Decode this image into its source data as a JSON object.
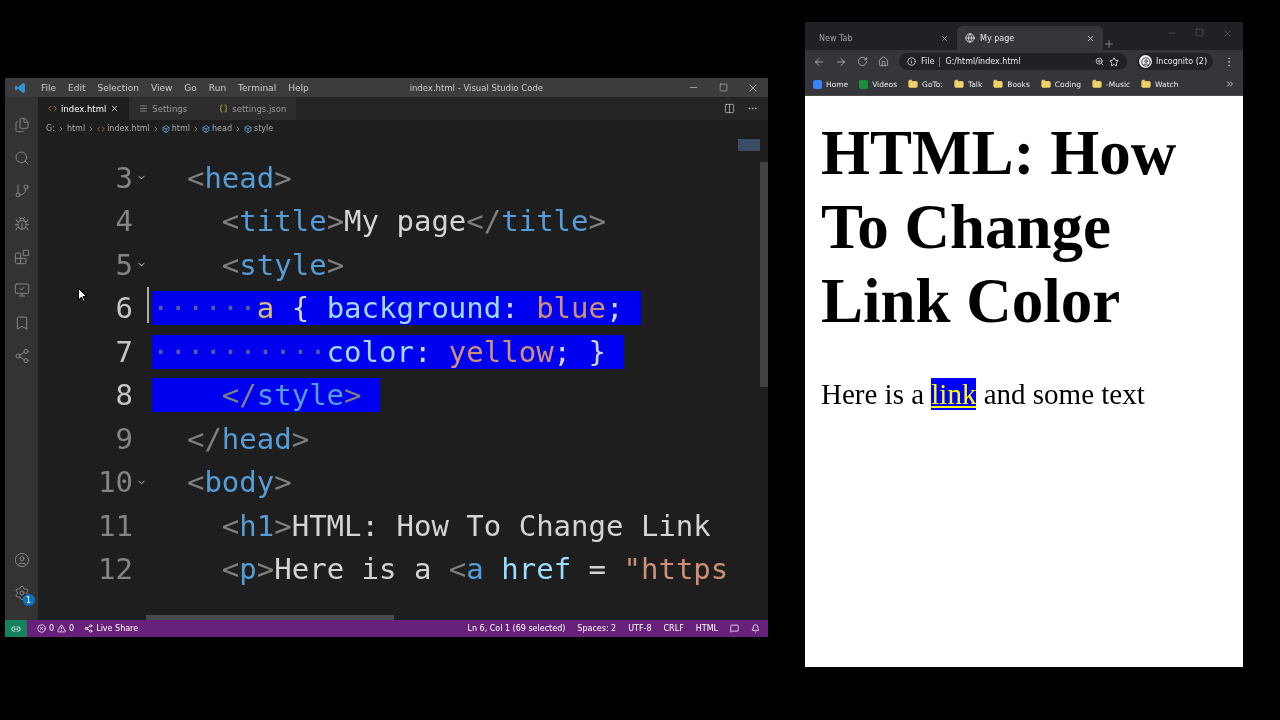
{
  "vscode": {
    "menu": [
      "File",
      "Edit",
      "Selection",
      "View",
      "Go",
      "Run",
      "Terminal",
      "Help"
    ],
    "title": "index.html - Visual Studio Code",
    "tabs": [
      {
        "label": "index.html",
        "kind": "html",
        "selected": true
      },
      {
        "label": "Settings",
        "kind": "settings",
        "selected": false
      },
      {
        "label": "settings.json",
        "kind": "json",
        "selected": false
      }
    ],
    "breadcrumbs": [
      {
        "label": "G:",
        "kind": "drive"
      },
      {
        "label": "html",
        "kind": "folder"
      },
      {
        "label": "index.html",
        "kind": "html"
      },
      {
        "label": "html",
        "kind": "element"
      },
      {
        "label": "head",
        "kind": "element"
      },
      {
        "label": "style",
        "kind": "element"
      }
    ],
    "lines": [
      {
        "number": "3",
        "foldable": true,
        "selected": false,
        "segments": [
          {
            "kind": "punct",
            "text": "  <"
          },
          {
            "kind": "tag",
            "text": "head"
          },
          {
            "kind": "punct",
            "text": ">"
          }
        ]
      },
      {
        "number": "4",
        "foldable": false,
        "selected": false,
        "segments": [
          {
            "kind": "punct",
            "text": "    <"
          },
          {
            "kind": "tag",
            "text": "title"
          },
          {
            "kind": "punct",
            "text": ">"
          },
          {
            "kind": "text",
            "text": "My page"
          },
          {
            "kind": "punct",
            "text": "</"
          },
          {
            "kind": "tag",
            "text": "title"
          },
          {
            "kind": "punct",
            "text": ">"
          }
        ]
      },
      {
        "number": "5",
        "foldable": true,
        "selected": false,
        "segments": [
          {
            "kind": "punct",
            "text": "    <"
          },
          {
            "kind": "tag",
            "text": "style"
          },
          {
            "kind": "punct",
            "text": ">"
          }
        ]
      },
      {
        "number": "6",
        "foldable": false,
        "selected": true,
        "segments": [
          {
            "kind": "ws",
            "text": "······"
          },
          {
            "kind": "selector",
            "text": "a"
          },
          {
            "kind": "text",
            "text": " { "
          },
          {
            "kind": "prop",
            "text": "background"
          },
          {
            "kind": "text",
            "text": ": "
          },
          {
            "kind": "value",
            "text": "blue"
          },
          {
            "kind": "text",
            "text": ";"
          }
        ]
      },
      {
        "number": "7",
        "foldable": false,
        "selected": true,
        "segments": [
          {
            "kind": "ws",
            "text": "··········"
          },
          {
            "kind": "prop",
            "text": "color"
          },
          {
            "kind": "text",
            "text": ": "
          },
          {
            "kind": "value",
            "text": "yellow"
          },
          {
            "kind": "text",
            "text": "; }"
          }
        ]
      },
      {
        "number": "8",
        "foldable": false,
        "selected": true,
        "segments": [
          {
            "kind": "punct",
            "text": "    </"
          },
          {
            "kind": "tag",
            "text": "style"
          },
          {
            "kind": "punct",
            "text": ">"
          }
        ]
      },
      {
        "number": "9",
        "foldable": false,
        "selected": false,
        "segments": [
          {
            "kind": "punct",
            "text": "  </"
          },
          {
            "kind": "tag",
            "text": "head"
          },
          {
            "kind": "punct",
            "text": ">"
          }
        ]
      },
      {
        "number": "10",
        "foldable": true,
        "selected": false,
        "segments": [
          {
            "kind": "punct",
            "text": "  <"
          },
          {
            "kind": "tag",
            "text": "body"
          },
          {
            "kind": "punct",
            "text": ">"
          }
        ]
      },
      {
        "number": "11",
        "foldable": false,
        "selected": false,
        "segments": [
          {
            "kind": "punct",
            "text": "    <"
          },
          {
            "kind": "tag",
            "text": "h1"
          },
          {
            "kind": "punct",
            "text": ">"
          },
          {
            "kind": "text",
            "text": "HTML: How To Change Link"
          }
        ]
      },
      {
        "number": "12",
        "foldable": false,
        "selected": false,
        "segments": [
          {
            "kind": "punct",
            "text": "    <"
          },
          {
            "kind": "tag",
            "text": "p"
          },
          {
            "kind": "punct",
            "text": ">"
          },
          {
            "kind": "text",
            "text": "Here is a "
          },
          {
            "kind": "punct",
            "text": "<"
          },
          {
            "kind": "tag",
            "text": "a"
          },
          {
            "kind": "prop",
            "text": " href"
          },
          {
            "kind": "text",
            "text": " = "
          },
          {
            "kind": "value",
            "text": "\"https"
          }
        ]
      }
    ],
    "status": {
      "errors": "0",
      "warnings": "0",
      "live_share": "Live Share",
      "right": [
        "Ln 6, Col 1 (69 selected)",
        "Spaces: 2",
        "UTF-8",
        "CRLF",
        "HTML"
      ]
    },
    "settings_badge": "1"
  },
  "browser": {
    "tabs": [
      {
        "label": "New Tab",
        "selected": false
      },
      {
        "label": "My page",
        "selected": true
      }
    ],
    "address": {
      "scheme": "File",
      "url": "G:/html/index.html"
    },
    "profile": "Incognito (2)",
    "bookmarks": [
      {
        "label": "Home",
        "kind": "app",
        "color": "#3b82f6"
      },
      {
        "label": "Videos",
        "kind": "app",
        "color": "#1e8e3e"
      },
      {
        "label": "GoTo:",
        "kind": "folder",
        "color": "#f2d06b"
      },
      {
        "label": "Talk",
        "kind": "folder",
        "color": "#f2d06b"
      },
      {
        "label": "Books",
        "kind": "folder",
        "color": "#f2d06b"
      },
      {
        "label": "Coding",
        "kind": "folder",
        "color": "#f2d06b"
      },
      {
        "label": "-Music",
        "kind": "folder",
        "color": "#f2d06b"
      },
      {
        "label": "Watch",
        "kind": "folder",
        "color": "#f2d06b"
      }
    ],
    "page": {
      "heading": "HTML: How To Change Link Color",
      "paragraph": {
        "before": "Here is a ",
        "link": "link",
        "after": " and some text"
      }
    }
  }
}
